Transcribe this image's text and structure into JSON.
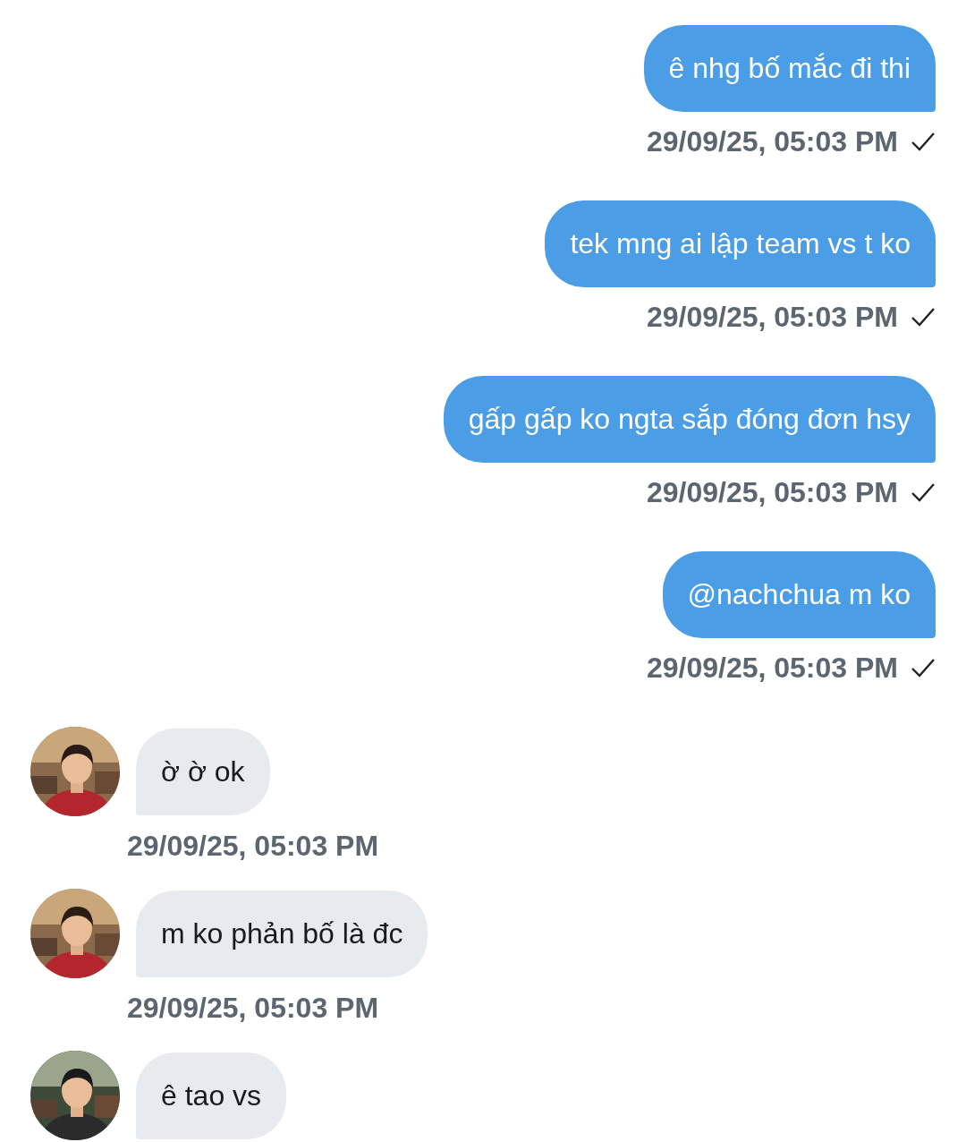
{
  "messages": [
    {
      "kind": "outgoing",
      "text": "ê nhg bố mắc đi thi",
      "time": "29/09/25, 05:03 PM",
      "sent": true
    },
    {
      "kind": "outgoing",
      "text": "tek mng ai lập team vs t ko",
      "time": "29/09/25, 05:03 PM",
      "sent": true
    },
    {
      "kind": "outgoing",
      "text": "gấp gấp ko ngta sắp đóng đơn hsy",
      "time": "29/09/25, 05:03 PM",
      "sent": true
    },
    {
      "kind": "outgoing",
      "text": "@nachchua m ko",
      "time": "29/09/25, 05:03 PM",
      "sent": true
    },
    {
      "kind": "incoming",
      "text": "ờ ờ ok",
      "time": "29/09/25, 05:03 PM"
    },
    {
      "kind": "incoming",
      "text": "m ko phản bố là đc",
      "time": "29/09/25, 05:03 PM"
    },
    {
      "kind": "incoming",
      "text": "ê tao vs"
    }
  ]
}
